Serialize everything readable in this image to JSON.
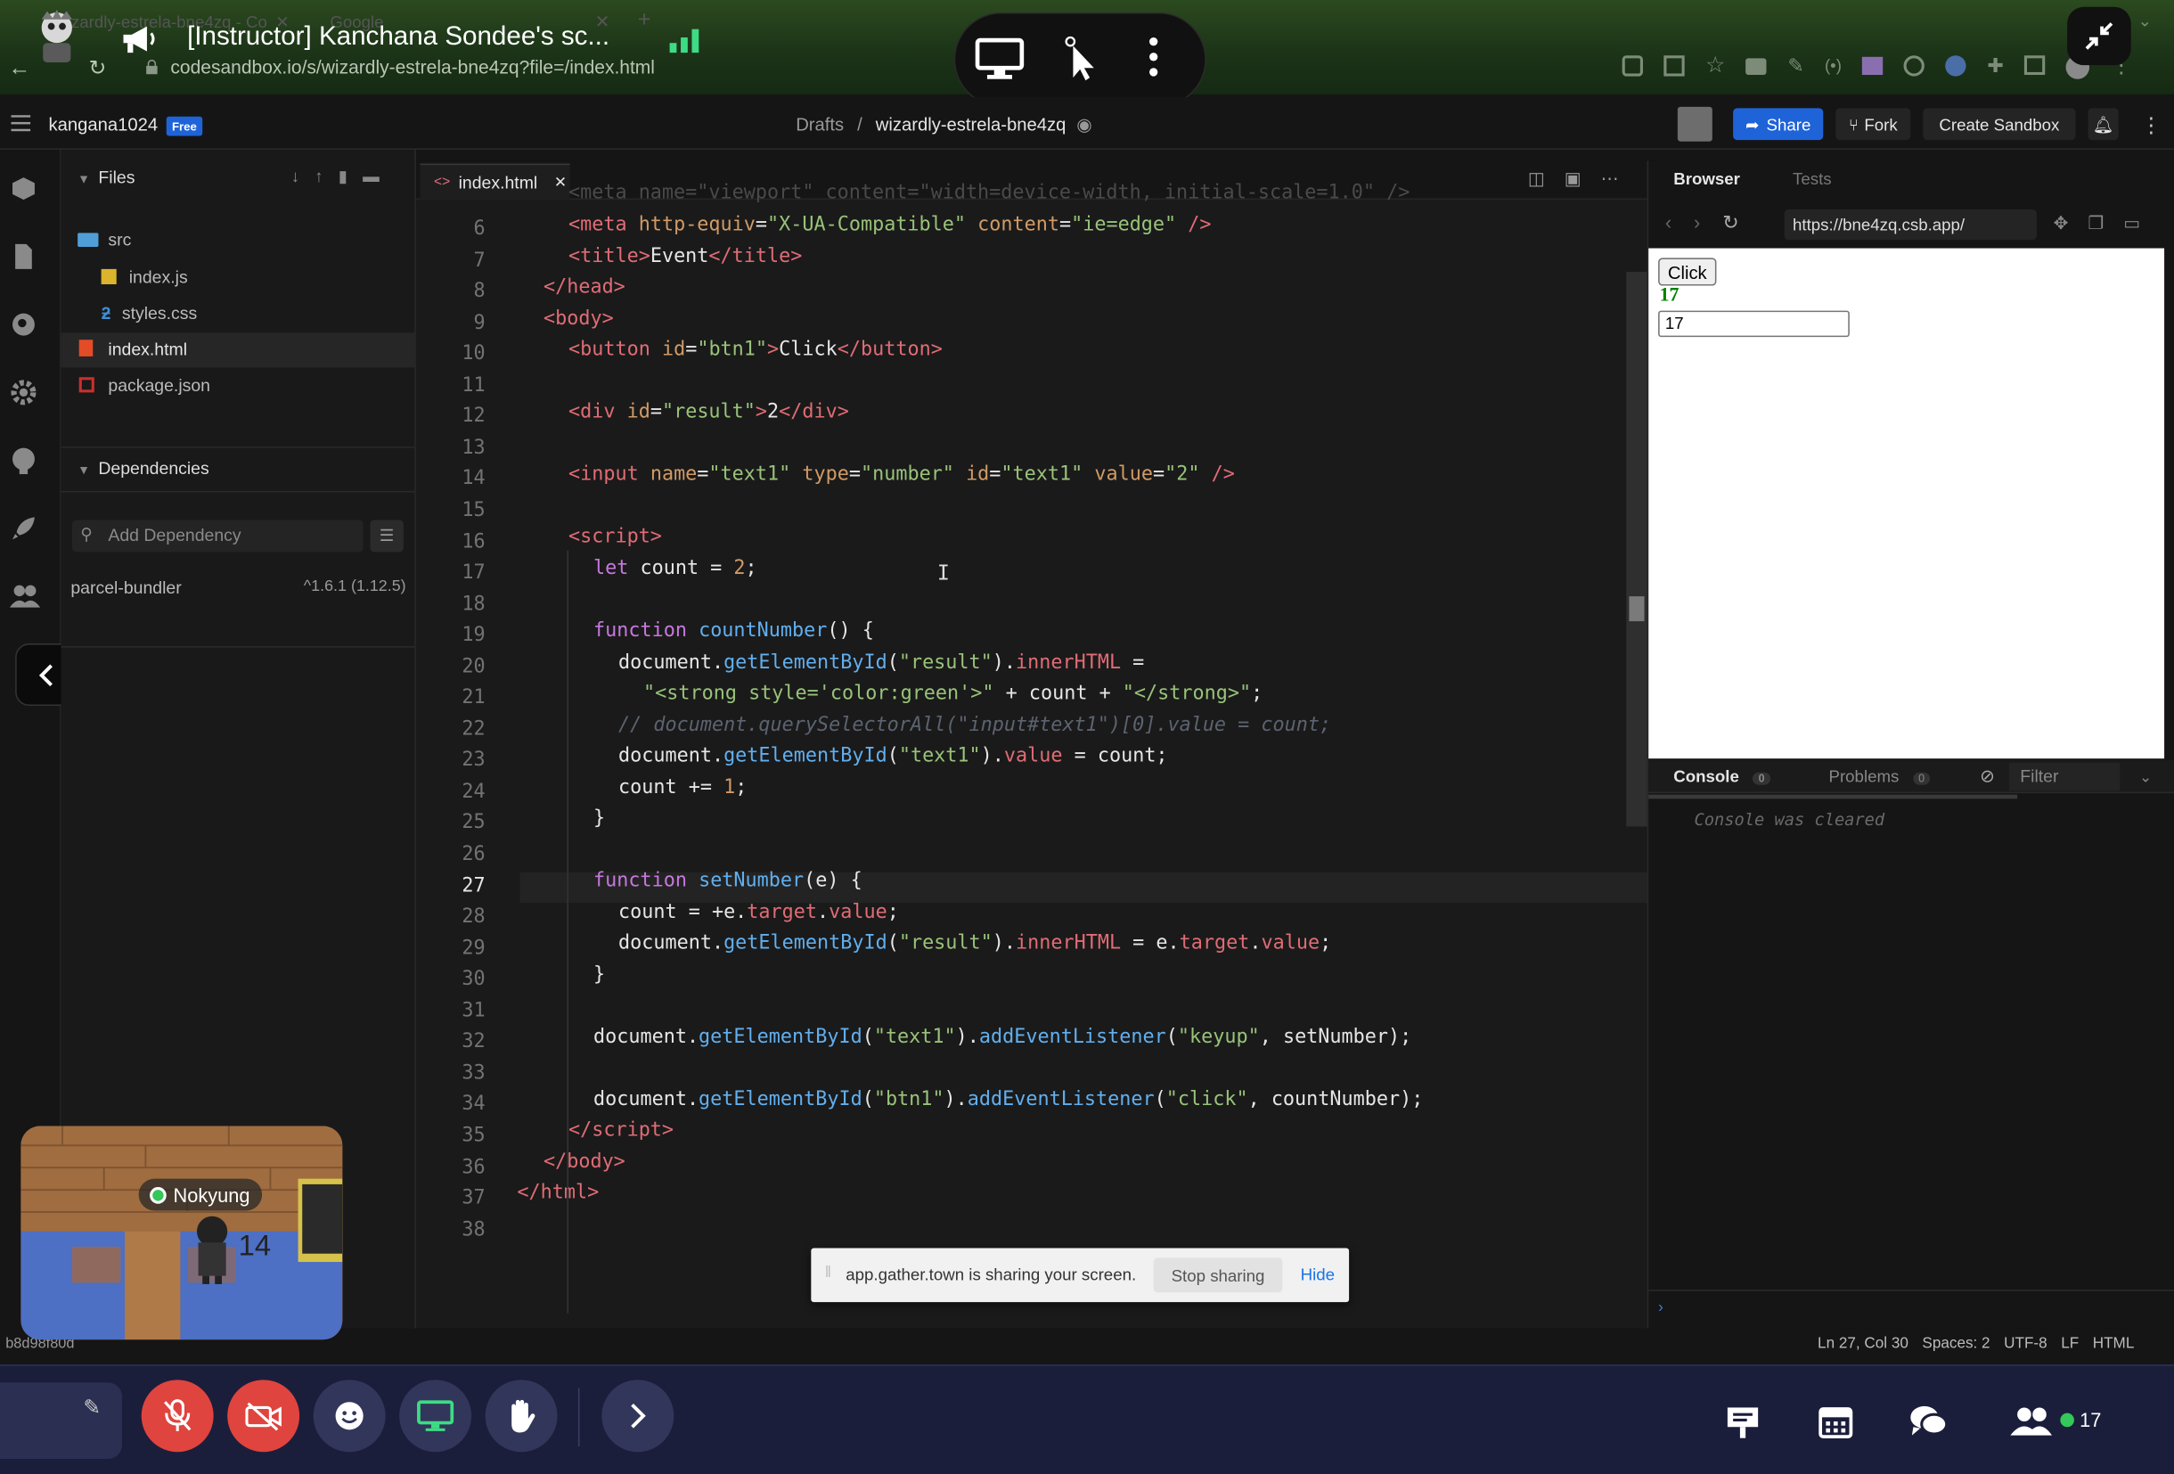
{
  "meeting": {
    "title": "[Instructor] Kanchana Sondee's sc...",
    "tab_ghost_1": "wizardly-estrela-bne4zq - Co",
    "tab_ghost_2": "Google",
    "url": "codesandbox.io/s/wizardly-estrela-bne4zq?file=/index.html"
  },
  "csb": {
    "username": "kangana1024",
    "plan_badge": "Free",
    "breadcrumb_root": "Drafts",
    "breadcrumb_sep": "/",
    "sandbox_name": "wizardly-estrela-bne4zq",
    "share_label": "Share",
    "fork_label": "Fork",
    "create_label": "Create Sandbox"
  },
  "explorer": {
    "files_header": "Files",
    "folder_src": "src",
    "files": [
      "index.js",
      "styles.css",
      "index.html",
      "package.json"
    ],
    "deps_header": "Dependencies",
    "add_dep_placeholder": "Add Dependency",
    "dep_name": "parcel-bundler",
    "dep_version": "^1.6.1 (1.12.5)"
  },
  "editor": {
    "tab_label": "index.html",
    "line_numbers": [
      "6",
      "7",
      "8",
      "9",
      "10",
      "11",
      "12",
      "13",
      "14",
      "15",
      "16",
      "17",
      "18",
      "19",
      "20",
      "21",
      "22",
      "23",
      "24",
      "25",
      "26",
      "27",
      "28",
      "29",
      "30",
      "31",
      "32",
      "33",
      "34",
      "35",
      "36",
      "37",
      "38"
    ],
    "current_line": "27"
  },
  "preview": {
    "tab_browser": "Browser",
    "tab_tests": "Tests",
    "url": "https://bne4zq.csb.app/",
    "button_label": "Click",
    "result_value": "17",
    "input_value": "17",
    "console_label": "Console",
    "console_count": "0",
    "problems_label": "Problems",
    "problems_count": "0",
    "filter_placeholder": "Filter",
    "console_message": "Console was cleared"
  },
  "statusbar": {
    "hash": "b8d98f80d",
    "position": "Ln 27, Col 30",
    "spaces": "Spaces: 2",
    "encoding": "UTF-8",
    "eol": "LF",
    "language": "HTML"
  },
  "share_banner": {
    "message": "app.gather.town is sharing your screen.",
    "stop_label": "Stop sharing",
    "hide_label": "Hide"
  },
  "gather": {
    "participant": "Nokyung",
    "counter": "14"
  },
  "bottombar": {
    "participant_count": "17"
  },
  "colors": {
    "share_blue": "#1f63d8",
    "mute_red": "#e0443e",
    "screen_green": "#3ddc84",
    "online_green": "#34c759"
  }
}
